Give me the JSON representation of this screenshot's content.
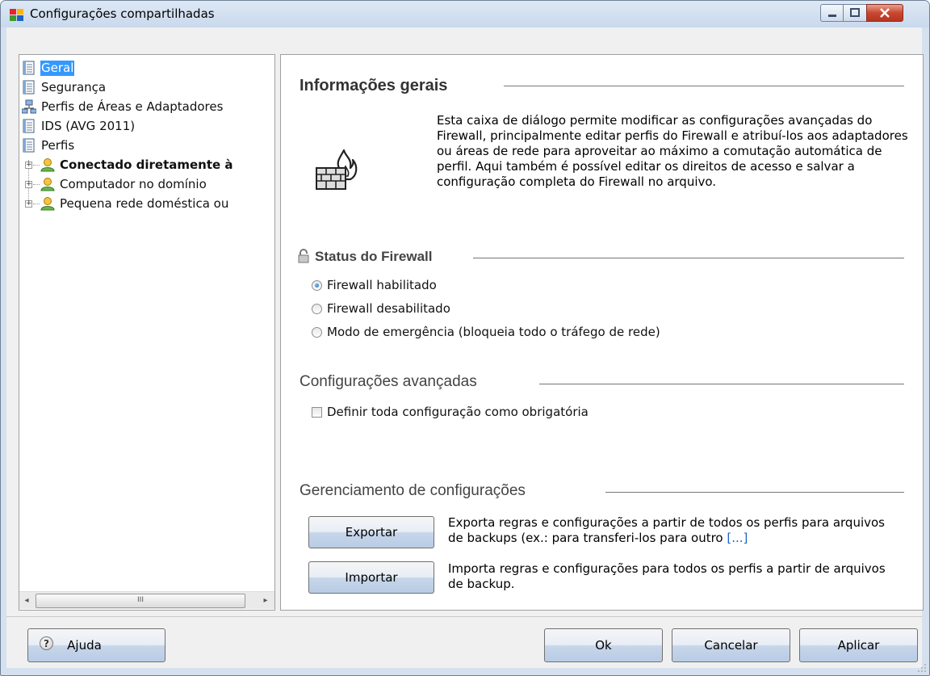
{
  "window": {
    "title": "Configurações compartilhadas",
    "controls": {
      "minimize": "minimize",
      "maximize": "maximize",
      "close": "close"
    }
  },
  "tree": {
    "items": [
      {
        "label": "Geral",
        "icon": "document-icon",
        "selected": true
      },
      {
        "label": "Segurança",
        "icon": "document-icon"
      },
      {
        "label": "Perfis de Áreas e Adaptadores",
        "icon": "network-icon"
      },
      {
        "label": "IDS (AVG 2011)",
        "icon": "document-icon"
      },
      {
        "label": "Perfis",
        "icon": "document-icon"
      },
      {
        "label": "Conectado diretamente à",
        "icon": "user-icon",
        "bold": true,
        "expander": "+"
      },
      {
        "label": "Computador no domínio",
        "icon": "user-icon",
        "expander": "+"
      },
      {
        "label": "Pequena rede doméstica ou",
        "icon": "user-icon",
        "expander": "+"
      }
    ],
    "scrollbar": {
      "left_arrow": "◂",
      "right_arrow": "▸",
      "thumb_grip": "III"
    }
  },
  "general_info": {
    "title": "Informações gerais",
    "icon": "firewall-icon",
    "description": "Esta caixa de diálogo permite modificar as configurações avançadas do Firewall, principalmente editar perfis do Firewall e atribuí-los aos adaptadores ou áreas de rede para aproveitar ao máximo a comutação automática de perfil. Aqui também é possível editar os direitos de acesso e salvar a configuração completa do Firewall no arquivo."
  },
  "firewall_status": {
    "title": "Status do Firewall",
    "icon": "lock-icon",
    "options": [
      {
        "label": "Firewall habilitado",
        "checked": true
      },
      {
        "label": "Firewall desabilitado",
        "checked": false
      },
      {
        "label": "Modo de emergência (bloqueia todo o tráfego de rede)",
        "checked": false
      }
    ]
  },
  "advanced": {
    "title": "Configurações avançadas",
    "checkbox_label": "Definir toda configuração como obrigatória",
    "checked": false
  },
  "management": {
    "title": "Gerenciamento de configurações",
    "export_button": "Exportar",
    "export_desc": "Exporta regras e configurações a partir de todos os perfis para arquivos de backups (ex.: para transferi-los para outro",
    "export_more": "[...]",
    "import_button": "Importar",
    "import_desc": "Importa regras e configurações para todos os perfis a partir de arquivos de backup."
  },
  "footer": {
    "help_button": "Ajuda",
    "help_icon": "?",
    "ok_button": "Ok",
    "cancel_button": "Cancelar",
    "apply_button": "Aplicar"
  },
  "colors": {
    "selection": "#3399ff",
    "link": "#1f62c9",
    "close_button": "#c8482f",
    "window_frame": "#c9d9ec"
  }
}
